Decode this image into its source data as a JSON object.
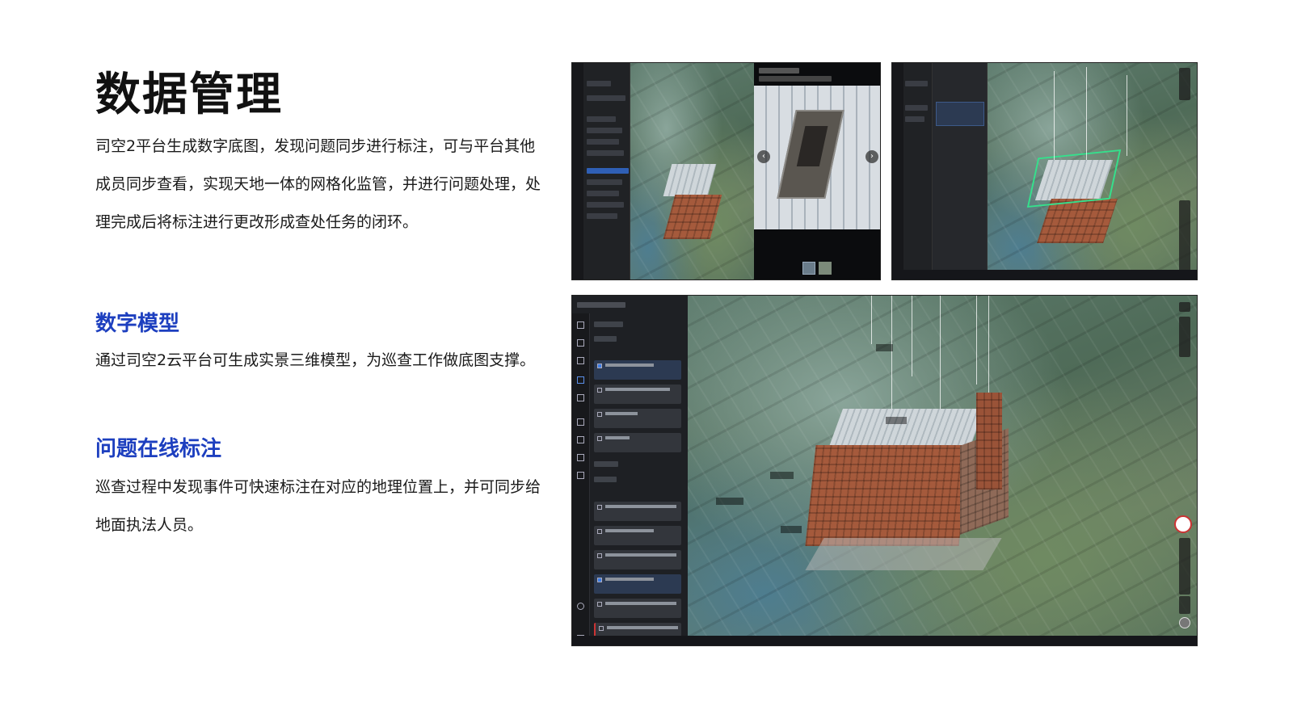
{
  "heading": "数据管理",
  "intro": "司空2平台生成数字底图，发现问题同步进行标注，可与平台其他成员同步查看，实现天地一体的网格化监管，并进行问题处理，处理完成后将标注进行更改形成查处任务的闭环。",
  "sections": [
    {
      "title": "数字模型",
      "body": "通过司空2云平台可生成实景三维模型，为巡查工作做底图支撑。"
    },
    {
      "title": "问题在线标注",
      "body": "巡查过程中发现事件可快速标注在对应的地理位置上，并可同步给地面执法人员。"
    }
  ],
  "colors": {
    "accent": "#1d3fbf",
    "panel": "#1e2024",
    "outline": "#35e08c",
    "building": "#a55a3c"
  }
}
